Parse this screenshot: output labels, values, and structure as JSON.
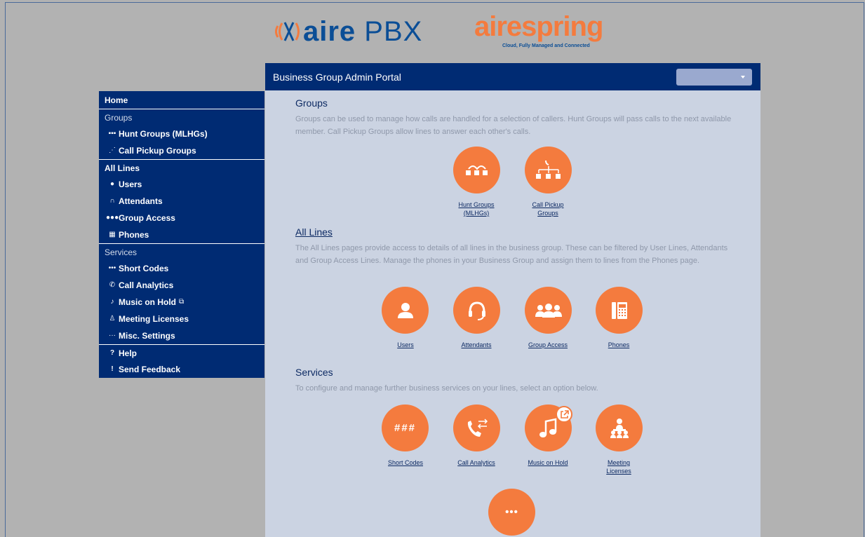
{
  "header": {
    "logo_aire": "aire",
    "logo_pbx": "PBX",
    "logo_airespring": "airespring",
    "logo_tagline": "Cloud, Fully Managed and Connected",
    "portal_title": "Business Group Admin Portal",
    "dropdown_value": ""
  },
  "sidebar": {
    "home": "Home",
    "groups_title": "Groups",
    "hunt_groups": "Hunt Groups (MLHGs)",
    "call_pickup": "Call Pickup Groups",
    "all_lines_title": "All Lines",
    "users": "Users",
    "attendants": "Attendants",
    "group_access": "Group Access",
    "phones": "Phones",
    "services_title": "Services",
    "short_codes": "Short Codes",
    "call_analytics": "Call Analytics",
    "music_on_hold": "Music on Hold",
    "meeting_licenses": "Meeting Licenses",
    "misc_settings": "Misc. Settings",
    "help": "Help",
    "send_feedback": "Send Feedback"
  },
  "main": {
    "groups_heading": "Groups",
    "groups_desc": "Groups can be used to manage how calls are handled for a selection of callers. Hunt Groups will pass calls to the next available member. Call Pickup Groups allow lines to answer each other's calls.",
    "hunt_groups_line1": "Hunt Groups",
    "hunt_groups_line2": "(MLHGs)",
    "call_pickup_line1": "Call Pickup",
    "call_pickup_line2": "Groups",
    "all_lines_heading": "All Lines",
    "all_lines_desc": "The All Lines pages provide access to details of all lines in the business group. These can be filtered by User Lines, Attendants and Group Access Lines. Manage the phones in your Business Group and assign them to lines from the Phones page.",
    "users": "Users",
    "attendants": "Attendants",
    "group_access": "Group Access",
    "phones": "Phones",
    "services_heading": "Services",
    "services_desc": "To configure and manage further business services on your lines, select an option below.",
    "short_codes": "Short Codes",
    "short_codes_glyph": "###",
    "call_analytics": "Call Analytics",
    "music_on_hold": "Music on Hold",
    "meeting_line1": "Meeting",
    "meeting_line2": "Licenses",
    "misc_glyph": "•••"
  },
  "colors": {
    "brand_navy": "#002b73",
    "accent_orange": "#f47b3e",
    "content_bg": "#cbd3e2",
    "page_bg": "#b2b2b2"
  }
}
